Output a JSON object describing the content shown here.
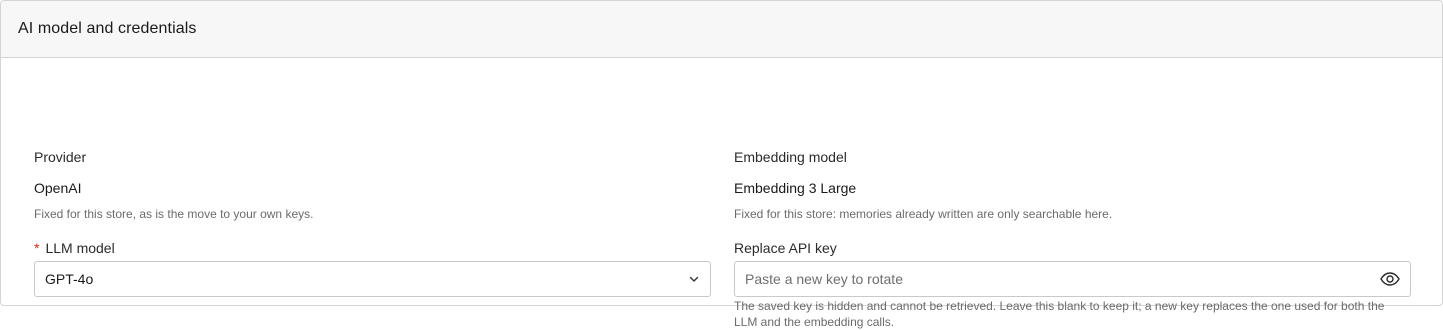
{
  "card": {
    "title": "AI model and credentials"
  },
  "provider": {
    "label": "Provider",
    "value": "OpenAI",
    "help": "Fixed for this store, as is the move to your own keys."
  },
  "embedding": {
    "label": "Embedding model",
    "value": "Embedding 3 Large",
    "help": "Fixed for this store: memories already written are only searchable here."
  },
  "llm_model": {
    "required_mark": "*",
    "label": "LLM model",
    "selected": "GPT-4o",
    "icon": "chevron-down-icon"
  },
  "api_key": {
    "label": "Replace API key",
    "value": "",
    "placeholder": "Paste a new key to rotate",
    "icon": "eye-icon",
    "help": "The saved key is hidden and cannot be retrieved. Leave this blank to keep it; a new key replaces the one used for both the LLM and the embedding calls."
  }
}
